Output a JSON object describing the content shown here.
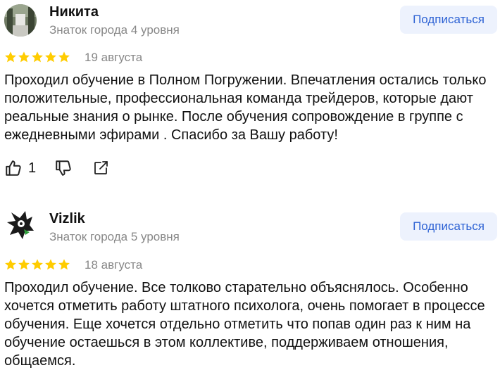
{
  "reviews": [
    {
      "name": "Никита",
      "level": "Знаток города 4 уровня",
      "subscribe_label": "Подписаться",
      "rating": 5,
      "date": "19 августа",
      "text": "Проходил обучение в Полном Погружении. Впечатления остались только положительные, профессиональная команда трейдеров, которые дают реальные знания о рынке. После обучения сопровождение в группе с ежедневными эфирами . Спасибо за Вашу работу!",
      "likes": "1"
    },
    {
      "name": "Vizlik",
      "level": "Знаток города 5 уровня",
      "subscribe_label": "Подписаться",
      "rating": 5,
      "date": "18 августа",
      "text": "Проходил обучение. Все толково старательно объяснялось. Особенно хочется отметить работу штатного психолога, очень помогает в процессе обучения. Еще хочется отдельно отметить что попав один раз к ним на обучение остаешься в этом коллективе, поддерживаем отношения, общаемся."
    }
  ],
  "colors": {
    "star": "#fc0",
    "subscribe_bg": "#edf2fd",
    "subscribe_text": "#2d62d4",
    "muted_text": "#888888"
  },
  "icons": [
    "thumbs-up-icon",
    "thumbs-down-icon",
    "share-icon",
    "star-icon"
  ]
}
